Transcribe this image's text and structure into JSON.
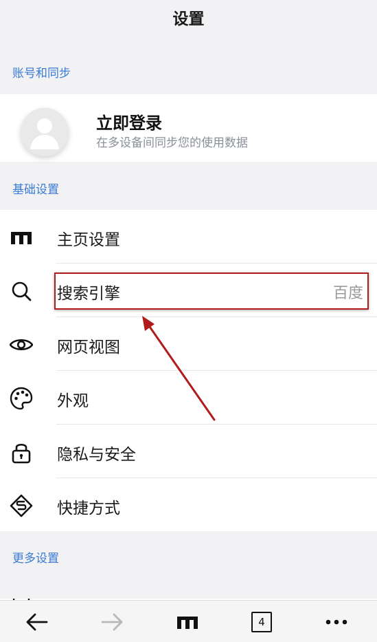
{
  "header": {
    "title": "设置"
  },
  "sections": {
    "account": "账号和同步",
    "basic": "基础设置",
    "more": "更多设置"
  },
  "account": {
    "login_title": "立即登录",
    "login_subtitle": "在多设备间同步您的使用数据"
  },
  "basic_items": [
    {
      "label": "主页设置",
      "icon": "home-icon"
    },
    {
      "label": "搜索引擎",
      "value": "百度",
      "icon": "search-icon"
    },
    {
      "label": "网页视图",
      "icon": "eye-icon"
    },
    {
      "label": "外观",
      "icon": "palette-icon"
    },
    {
      "label": "隐私与安全",
      "icon": "lock-icon"
    },
    {
      "label": "快捷方式",
      "icon": "shortcut-icon"
    }
  ],
  "bottom_nav": {
    "tab_count": "4",
    "icons": [
      "back-arrow-icon",
      "forward-arrow-icon",
      "home-icon",
      "tabs-icon",
      "more-icon"
    ]
  },
  "colors": {
    "accent": "#3a7bd5",
    "annotation": "#b01c1c"
  }
}
